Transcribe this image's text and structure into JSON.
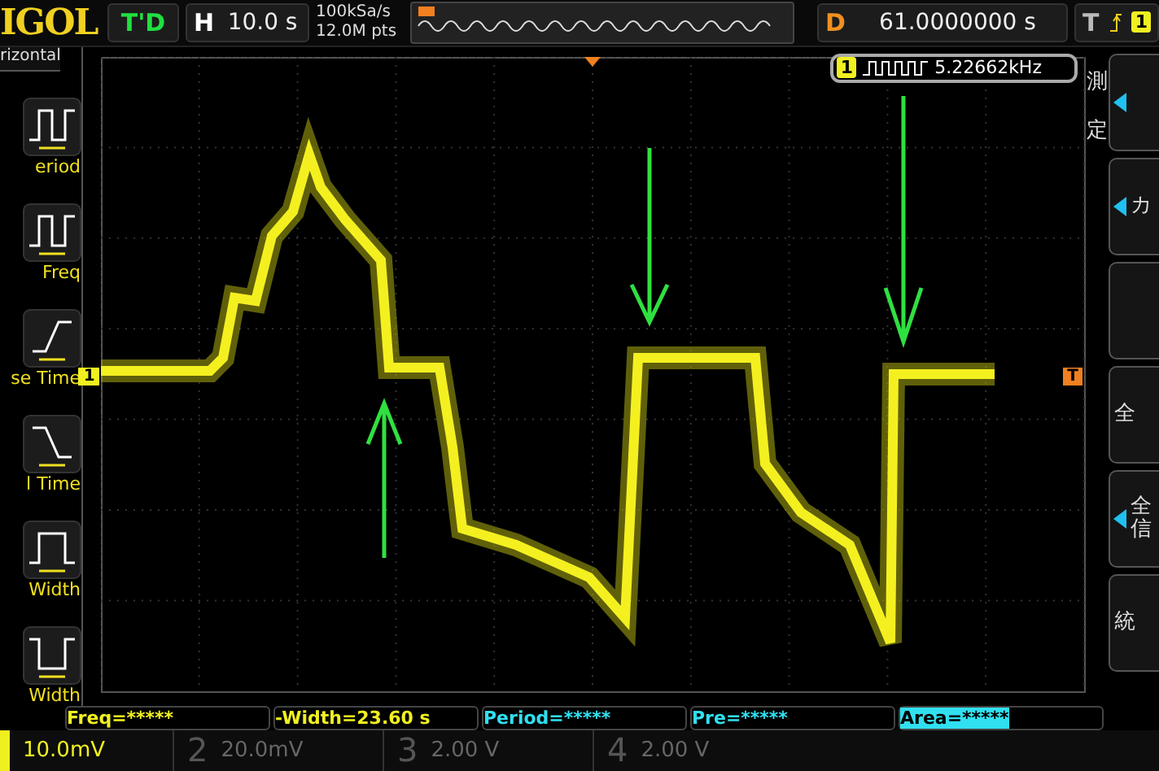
{
  "header": {
    "logo": "IGOL",
    "mode": "T'D",
    "timebase": {
      "label": "H",
      "value": "10.0 s"
    },
    "sample_rate": "100kSa/s",
    "memory_depth": "12.0M pts",
    "delay": {
      "label": "D",
      "value": "61.0000000 s"
    },
    "trigger": {
      "label": "T",
      "source": "1"
    }
  },
  "left_panel": {
    "title": "rizontal",
    "items": [
      {
        "kind": "period",
        "label": "eriod"
      },
      {
        "kind": "freq",
        "label": "Freq"
      },
      {
        "kind": "rise",
        "label": "se Time"
      },
      {
        "kind": "fall",
        "label": "l Time"
      },
      {
        "kind": "pwidth",
        "label": "Width"
      },
      {
        "kind": "nwidth",
        "label": "Width"
      }
    ]
  },
  "screen": {
    "channel_marker": "1",
    "trigger_marker": "T",
    "frequency": {
      "channel": "1",
      "value": "5.22662kHz"
    }
  },
  "right_panel": {
    "title": [
      "測",
      "定"
    ],
    "buttons": [
      {
        "arrow": true
      },
      {
        "text": "カ",
        "arrow": true
      },
      {
        "arrow": false
      },
      {
        "text": "全",
        "arrow": false
      },
      {
        "text": "全信",
        "arrow": true
      },
      {
        "text": "統",
        "arrow": false
      }
    ]
  },
  "measurements": [
    {
      "text": "Freq=*****",
      "color": "#f0f020",
      "selected": false
    },
    {
      "text": "-Width=23.60 s",
      "color": "#f0f020",
      "selected": false
    },
    {
      "text": "Period=*****",
      "color": "#30e0f0",
      "selected": false
    },
    {
      "text": "Pre=*****",
      "color": "#30e0f0",
      "selected": false
    },
    {
      "text": "Area=*****",
      "color": "#30e0f0",
      "selected": true
    }
  ],
  "channels": [
    {
      "scale": "10.0mV",
      "active": true
    },
    {
      "number": "2",
      "scale": "20.0mV",
      "active": false
    },
    {
      "number": "3",
      "scale": "2.00 V",
      "active": false
    },
    {
      "number": "4",
      "scale": "2.00 V",
      "active": false
    }
  ]
}
